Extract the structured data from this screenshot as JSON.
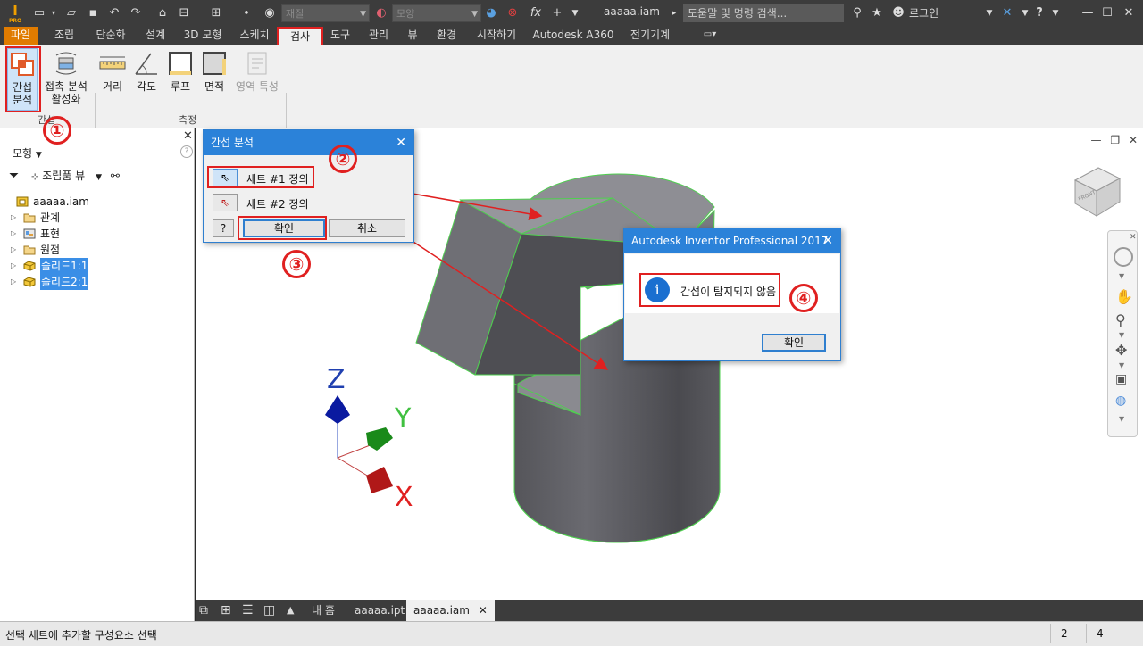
{
  "titlebar": {
    "app_logo": "I",
    "app_logo_sub": "PRO",
    "material_combo": "재질",
    "appearance_combo": "모양",
    "filename": "aaaaa.iam",
    "search_placeholder": "도움말 및 명령 검색...",
    "login": "로그인"
  },
  "ribbon_tabs": [
    "파일",
    "조립",
    "단순화",
    "설계",
    "3D 모형",
    "스케치",
    "검사",
    "도구",
    "관리",
    "뷰",
    "환경",
    "시작하기",
    "Autodesk A360",
    "전기기계"
  ],
  "ribbon": {
    "interference_btn": "간섭\n분석",
    "contact_btn": "접촉 분석\n활성화",
    "distance_btn": "거리",
    "angle_btn": "각도",
    "loop_btn": "루프",
    "area_btn": "면적",
    "region_btn": "영역 특성",
    "panel_interference": "간섭",
    "panel_measure": "측정"
  },
  "browser": {
    "title": "모형",
    "view_label": "조립품 뷰",
    "tree": [
      {
        "label": "aaaaa.iam",
        "icon": "assembly-icon",
        "selected": false,
        "root": true
      },
      {
        "label": "관계",
        "icon": "folder-icon",
        "selected": false
      },
      {
        "label": "표현",
        "icon": "representation-icon",
        "selected": false
      },
      {
        "label": "원점",
        "icon": "folder-icon",
        "selected": false
      },
      {
        "label": "솔리드1:1",
        "icon": "part-icon",
        "selected": true
      },
      {
        "label": "솔리드2:1",
        "icon": "part-icon",
        "selected": true
      }
    ]
  },
  "interference_dialog": {
    "title": "간섭 분석",
    "set1_label": "세트 #1 정의",
    "set2_label": "세트 #2 정의",
    "ok": "확인",
    "cancel": "취소",
    "help": "?"
  },
  "message_dialog": {
    "title": "Autodesk Inventor Professional 2017",
    "message": "간섭이 탐지되지 않음",
    "ok": "확인"
  },
  "annotations": [
    "①",
    "②",
    "③",
    "④"
  ],
  "axes": {
    "z": "Z",
    "y": "Y",
    "x": "X"
  },
  "view_cube_label": "FRONT",
  "doc_tabs": [
    "내 홈",
    "aaaaa.ipt",
    "aaaaa.iam"
  ],
  "statusbar": {
    "text": "선택 세트에 추가할 구성요소 선택",
    "count1": "2",
    "count2": "4"
  },
  "colors": {
    "accent": "#2b82d9",
    "annotation": "#e02020",
    "file_tab": "#e07b00",
    "highlight_edge": "#4fd04f"
  }
}
